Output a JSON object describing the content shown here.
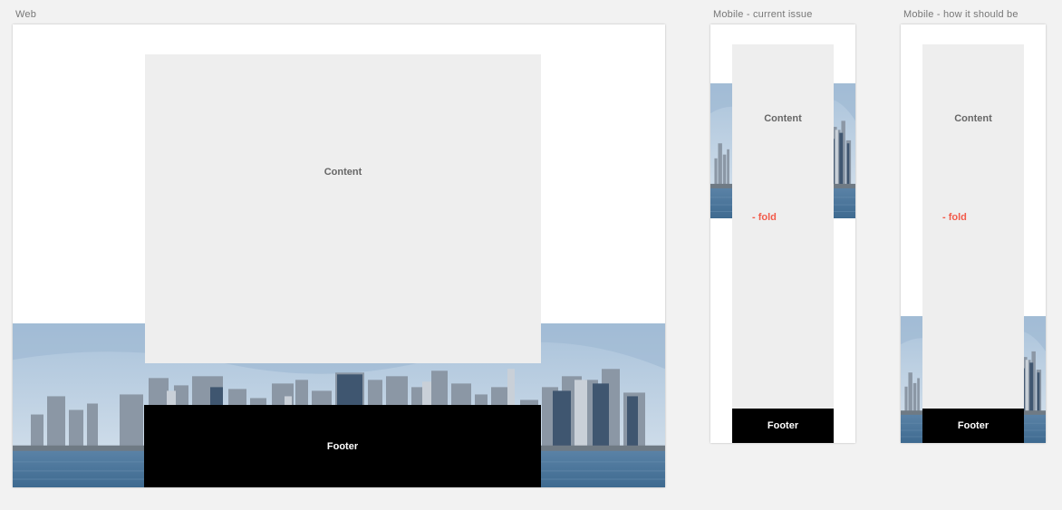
{
  "artboards": {
    "web": {
      "label": "Web",
      "content_label": "Content",
      "footer_label": "Footer"
    },
    "mobile_current": {
      "label": "Mobile - current issue",
      "content_label": "Content",
      "fold_label": "- fold",
      "footer_label": "Footer"
    },
    "mobile_expected": {
      "label": "Mobile - how it should be",
      "content_label": "Content",
      "fold_label": "- fold",
      "footer_label": "Footer"
    }
  },
  "colors": {
    "canvas": "#f2f2f2",
    "artboard": "#ffffff",
    "content": "#eeeeee",
    "footer": "#000000",
    "fold": "#f25a4a",
    "sky": "#b8cde0",
    "water": "#4b7497"
  },
  "background_image": "city-skyline-photo"
}
